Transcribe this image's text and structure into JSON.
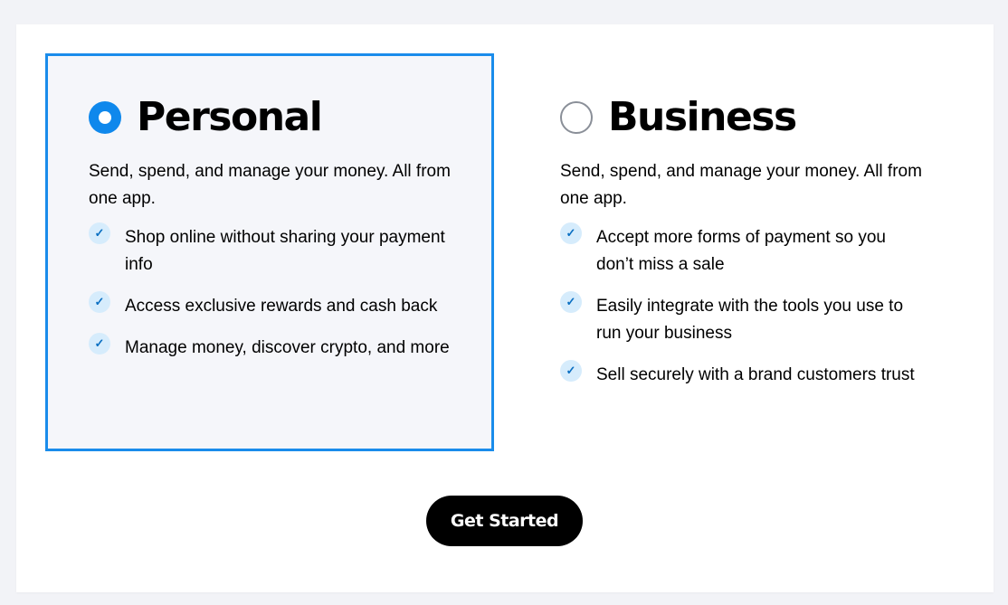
{
  "colors": {
    "accent": "#1a8ceb",
    "radio_selected": "#0f88ec",
    "check_bg": "#d6ecfc",
    "check_fg": "#0a6fc2",
    "selected_bg": "#f5f6fa",
    "cta_bg": "#000000",
    "page_bg": "#f2f3f7"
  },
  "options": [
    {
      "title": "Personal",
      "selected": true,
      "description": "Send, spend, and manage your money. All from one app.",
      "features": [
        {
          "icon": "check-icon",
          "text": "Shop online without sharing your payment info"
        },
        {
          "icon": "check-icon",
          "text": "Access exclusive rewards and cash back"
        },
        {
          "icon": "check-icon",
          "text": "Manage money, discover crypto, and more"
        }
      ]
    },
    {
      "title": "Business",
      "selected": false,
      "description": "Send, spend, and manage your money. All from one app.",
      "features": [
        {
          "icon": "check-icon",
          "text": "Accept more forms of payment so you don’t miss a sale"
        },
        {
          "icon": "check-icon",
          "text": "Easily integrate with the tools you use to run your business"
        },
        {
          "icon": "check-icon",
          "text": "Sell securely with a brand customers trust"
        }
      ]
    }
  ],
  "cta": {
    "label": "Get Started"
  }
}
